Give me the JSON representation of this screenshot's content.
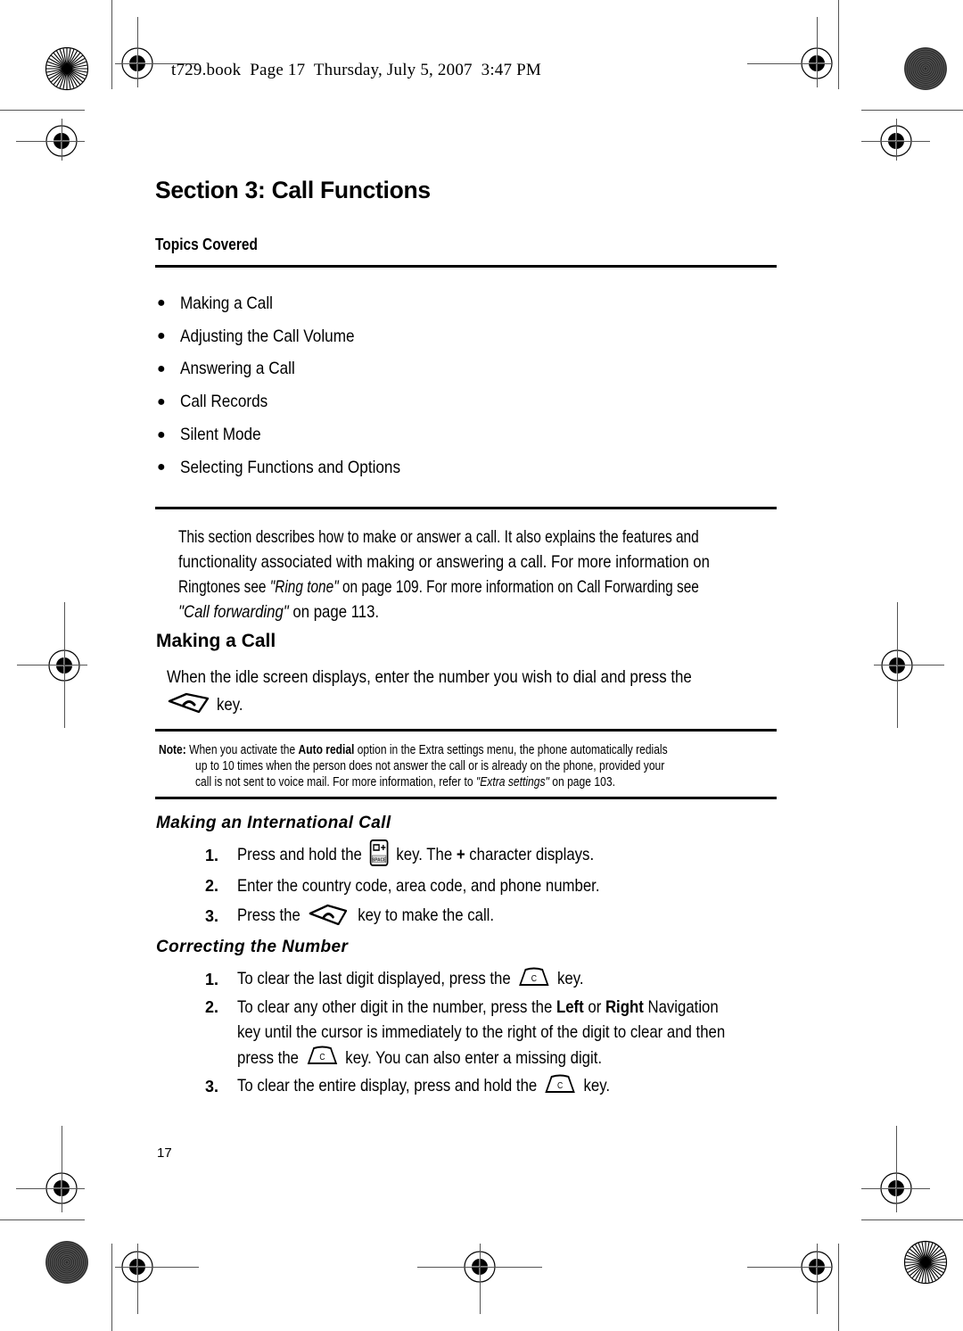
{
  "header": {
    "stamp": "t729.book  Page 17  Thursday, July 5, 2007  3:47 PM"
  },
  "section": {
    "title": "Section 3: Call Functions",
    "topics_label": "Topics Covered",
    "topics": [
      "Making a Call",
      "Adjusting the Call Volume",
      "Answering a Call",
      "Call Records",
      "Silent Mode",
      "Selecting Functions and Options"
    ]
  },
  "intro": {
    "line1": "This section describes how to make or answer a call. It also explains the features and",
    "line2": "functionality associated with making or answering a call. For more information on",
    "line3_pre": "Ringtones see ",
    "line3_ref": "\"Ring tone\"",
    "line3_post": " on page 109. For more information on Call Forwarding see",
    "line4_ref": "\"Call forwarding\"",
    "line4_post": "  on page 113."
  },
  "making_call": {
    "heading": "Making a Call",
    "line1": "When the idle screen displays, enter the number you wish to dial and press the",
    "line2_post": " key.",
    "send_key_icon": "send-key-icon"
  },
  "note": {
    "label": "Note:",
    "pre": " When you activate the ",
    "bold": "Auto redial",
    "post": " option in the Extra settings menu, the phone automatically redials",
    "line2": "up to 10 times when the person does not answer the call or is already on the phone, provided your",
    "line3_pre": "call is not sent to voice mail. For more information, refer to ",
    "line3_ref": "\"Extra settings\"",
    "line3_post": "  on page 103."
  },
  "international": {
    "heading": "Making an International Call",
    "steps": [
      {
        "num": "1.",
        "pre": "Press and hold the ",
        "post": " key. The ",
        "bold": "+",
        "post2": " character displays."
      },
      {
        "num": "2.",
        "text": "Enter the country code, area code, and phone number."
      },
      {
        "num": "3.",
        "pre": "Press the ",
        "post": " key to make the call."
      }
    ],
    "zero_key_label_top": "0+",
    "zero_key_label_bottom": "SPACE"
  },
  "correcting": {
    "heading": "Correcting the Number",
    "steps": [
      {
        "num": "1.",
        "pre": "To clear the last digit displayed, press the ",
        "post": " key."
      },
      {
        "num": "2.",
        "l1_pre": "To clear any other digit in the number, press the ",
        "l1_b1": "Left",
        "l1_mid": " or ",
        "l1_b2": "Right",
        "l1_post": " Navigation",
        "l2": "key until the cursor is immediately to the right of the digit to clear and then",
        "l3_pre": "press the ",
        "l3_post": " key. You can also enter a missing digit."
      },
      {
        "num": "3.",
        "pre": "To clear the entire display, press and hold the ",
        "post": " key."
      }
    ],
    "clear_key_label": "C"
  },
  "footer": {
    "page_number": "17"
  }
}
